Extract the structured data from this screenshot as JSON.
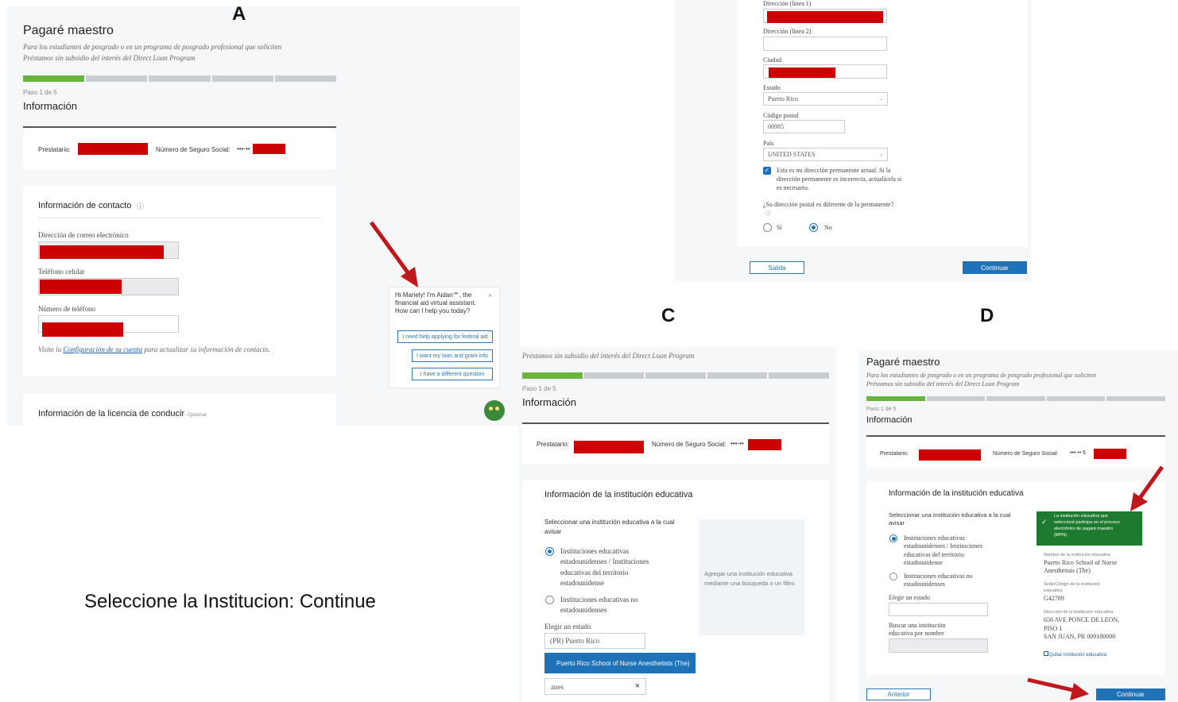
{
  "labels": {
    "a": "A",
    "c": "C",
    "d": "D"
  },
  "caption": "Seleccione la Institucion: Continue",
  "panel_a": {
    "title": "Pagaré maestro",
    "subtitle_1": "Para los estudiantes de posgrado o en un programa de posgrado profesional que soliciten",
    "subtitle_2": "Préstamos sin subsidio del interés del Direct Loan Program",
    "step": "Paso 1 de 5",
    "section": "Información",
    "borrower_label": "Prestatario:",
    "ssn_label": "Número de Seguro Social:",
    "ssn_mask": "•••-••",
    "contact_title": "Información de contacto",
    "email_label": "Dirección de correo electrónico",
    "cell_label": "Teléfono celular",
    "phone_label": "Número de teléfono",
    "visit_pre": "Visite la",
    "visit_link": "Configuración de su cuenta",
    "visit_post": "para actualizar su información de contacto.",
    "license_title": "Información de la licencia de conducir",
    "license_optional": "- Opcional",
    "chat_greeting": "Hi Mariely! I'm Aidan℠, the financial aid virtual assistant. How can I help you today?",
    "chat_btn_1": "I need help applying for federal aid",
    "chat_btn_2": "I want my loan and grant info",
    "chat_btn_3": "I have a different question"
  },
  "panel_b": {
    "addr1_label": "Dirección (línea 1)",
    "addr2_label": "Dirección (línea 2)",
    "city_label": "Ciudad",
    "state_label": "Estado",
    "state_value": "Puerto Rico",
    "zip_label": "Código postal",
    "zip_value": "00985",
    "country_label": "País",
    "country_value": "UNITED STATES",
    "perm_text_1": "Esta es mi dirección permanente actual. Si la",
    "perm_text_2": "dirección permanente es incorrecta, actualícela si",
    "perm_text_3": "es necesario.",
    "mail_question": "¿Su dirección postal es diferente de la permanente?",
    "opt_si": "Sí",
    "opt_no": "No",
    "btn_exit": "Salida",
    "btn_continue": "Continuar"
  },
  "panel_c": {
    "subtitle_2": "Préstamos sin subsidio del interés del Direct Loan Program",
    "step": "Paso 1 de 5",
    "section": "Información",
    "borrower_label": "Prestatario:",
    "ssn_label": "Número de Seguro Social:",
    "ssn_mask": "•••-••",
    "inst_title": "Información de la institución educativa",
    "select_1": "Seleccionar una institución educativa a la cual",
    "select_2": "avisar",
    "opt_us_1": "Instituciones educativas",
    "opt_us_2": "estadounidenses / Instituciones",
    "opt_us_3": "educativas del territorio",
    "opt_us_4": "estadounidense",
    "opt_non_1": "Instituciones educativas no",
    "opt_non_2": "estadounidenses",
    "choose_state": "Elegir un estado",
    "state_value": "(PR) Puerto Rico",
    "suggestion": "Puerto Rico School of Nurse Anesthetists (The)",
    "search_value": "anes",
    "clear_x": "×",
    "add_hint_1": "Agregar una institución educativa",
    "add_hint_2": "mediante una búsqueda o un filtro"
  },
  "panel_d": {
    "title": "Pagaré maestro",
    "subtitle_1": "Para los estudiantes de posgrado o en un programa de posgrado profesional que soliciten",
    "subtitle_2": "Préstamos sin subsidio del interés del Direct Loan Program",
    "step": "Paso 1 de 5",
    "section": "Información",
    "borrower_label": "Prestatario:",
    "ssn_label": "Número de Seguro Social:",
    "ssn_mask": "••• •• 6",
    "inst_title": "Información de la institución educativa",
    "select_1": "Seleccionar una institución educativa a la cual",
    "select_2": "avisar",
    "opt_us_1": "Instituciones educativas",
    "opt_us_2": "estadounidenses / Instituciones",
    "opt_us_3": "educativas del territorio",
    "opt_us_4": "estadounidense",
    "opt_non_1": "Instituciones educativas no",
    "opt_non_2": "estadounidenses",
    "choose_state": "Elegir un estado",
    "search_name_1": "Buscar una institución",
    "search_name_2": "educativa por nombre",
    "notice_1": "La institución educativa que",
    "notice_2": "seleccionó participa en el proceso",
    "notice_3": "electrónico de pagaré maestro",
    "notice_4": "(MPN).",
    "inst_name_label": "Nombre de la institución educativa",
    "inst_name_1": "Puerto Rico School of Nurse",
    "inst_name_2": "Anesthetists (The)",
    "code_label_1": "Sede/Código de la institución",
    "code_label_2": "educativa",
    "code_value": "G42789",
    "addr_label_1": "Dirección de la institución educativa",
    "addr_1": "656 AVE PONCE DE LEON,",
    "addr_2": "PISO 1",
    "addr_3": "SAN JUAN, PR 009180000",
    "remove": "Quitar institución educativa",
    "btn_prev": "Anterior",
    "btn_continue": "Continuar"
  },
  "colors": {
    "redaction": "#cc0000",
    "arrow": "#c0171c",
    "progress": "#6ab43e",
    "primary": "#1f72b8",
    "notice": "#1e7a2e"
  }
}
